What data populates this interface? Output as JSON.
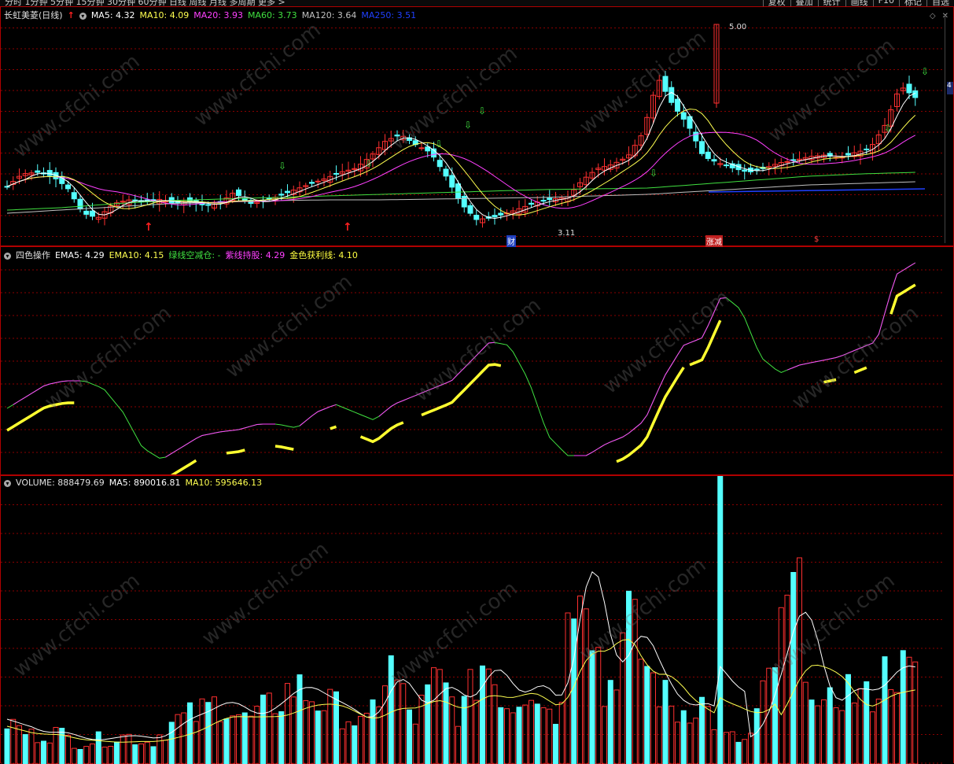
{
  "toolbar": {
    "periods_text": "分时  1分钟  5分钟  15分钟  30分钟  60分钟  日线  周线  月线  多周期  更多 >",
    "buttons": [
      "复权",
      "叠加",
      "统计",
      "画线",
      "F10",
      "标记",
      "自选"
    ]
  },
  "colors": {
    "up": "#ff3030",
    "down": "#54ffff",
    "ma5": "#ffffff",
    "ma10": "#ffff50",
    "ma20": "#ff40ff",
    "ma60": "#40e040",
    "ma120": "#c0c0c0",
    "ma250": "#2040ff",
    "grid": "#8a0000"
  },
  "price_panel": {
    "stock_title": "长虹美菱(日线)",
    "ma5": "MA5: 4.32",
    "ma10": "MA10: 4.09",
    "ma20": "MA20: 3.93",
    "ma60": "MA60: 3.73",
    "ma120": "MA120: 3.64",
    "ma250": "MA250: 3.51",
    "high_label": "5.00",
    "low_label": "3.11",
    "markers": [
      "财",
      "涨减",
      "$"
    ],
    "side_tag": "4"
  },
  "indicator_panel": {
    "name": "四色操作",
    "ema5": "EMA5: 4.29",
    "ema10": "EMA10: 4.15",
    "green_line": "绿线空减仓: -",
    "purple_line": "紫线持股: 4.29",
    "gold_line": "金色获利线: 4.10"
  },
  "volume_panel": {
    "volume": "VOLUME: 888479.69",
    "ma5": "MA5: 890016.81",
    "ma10": "MA10: 595646.13"
  },
  "watermark": "www.cfchi.com"
}
